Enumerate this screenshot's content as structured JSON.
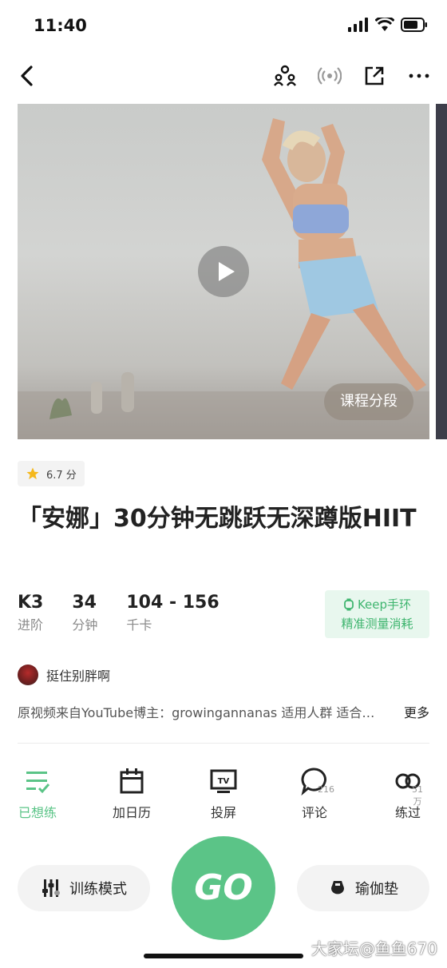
{
  "status_bar": {
    "time": "11:40"
  },
  "video": {
    "segment_button": "课程分段"
  },
  "rating": {
    "value": "6.7 分"
  },
  "course": {
    "title": "「安娜」30分钟无跳跃无深蹲版HIIT"
  },
  "stats": [
    {
      "value": "K3",
      "label": "进阶"
    },
    {
      "value": "34",
      "label": "分钟"
    },
    {
      "value": "104 - 156",
      "label": "千卡"
    }
  ],
  "keep_badge": {
    "line1": "Keep手环",
    "line2": "精准测量消耗"
  },
  "author": {
    "name": "挺住别胖啊"
  },
  "description": {
    "text": "原视频来自YouTube博主：growingannanas 适用人群 适合…",
    "more": "更多"
  },
  "actions": [
    {
      "label": "已想练",
      "icon": "check-list-icon",
      "count": ""
    },
    {
      "label": "加日历",
      "icon": "calendar-icon",
      "count": ""
    },
    {
      "label": "投屏",
      "icon": "tv-icon",
      "count": ""
    },
    {
      "label": "评论",
      "icon": "comment-icon",
      "count": "216"
    },
    {
      "label": "练过",
      "icon": "trained-icon",
      "count": "51万"
    }
  ],
  "bottom": {
    "mode_label": "训练模式",
    "go_label": "GO",
    "equipment_label": "瑜伽垫"
  },
  "watermark": "大家坛@鱼鱼670",
  "colors": {
    "accent": "#5bc487",
    "badge_text": "#3fb56f",
    "badge_bg": "#e8f7ee"
  }
}
